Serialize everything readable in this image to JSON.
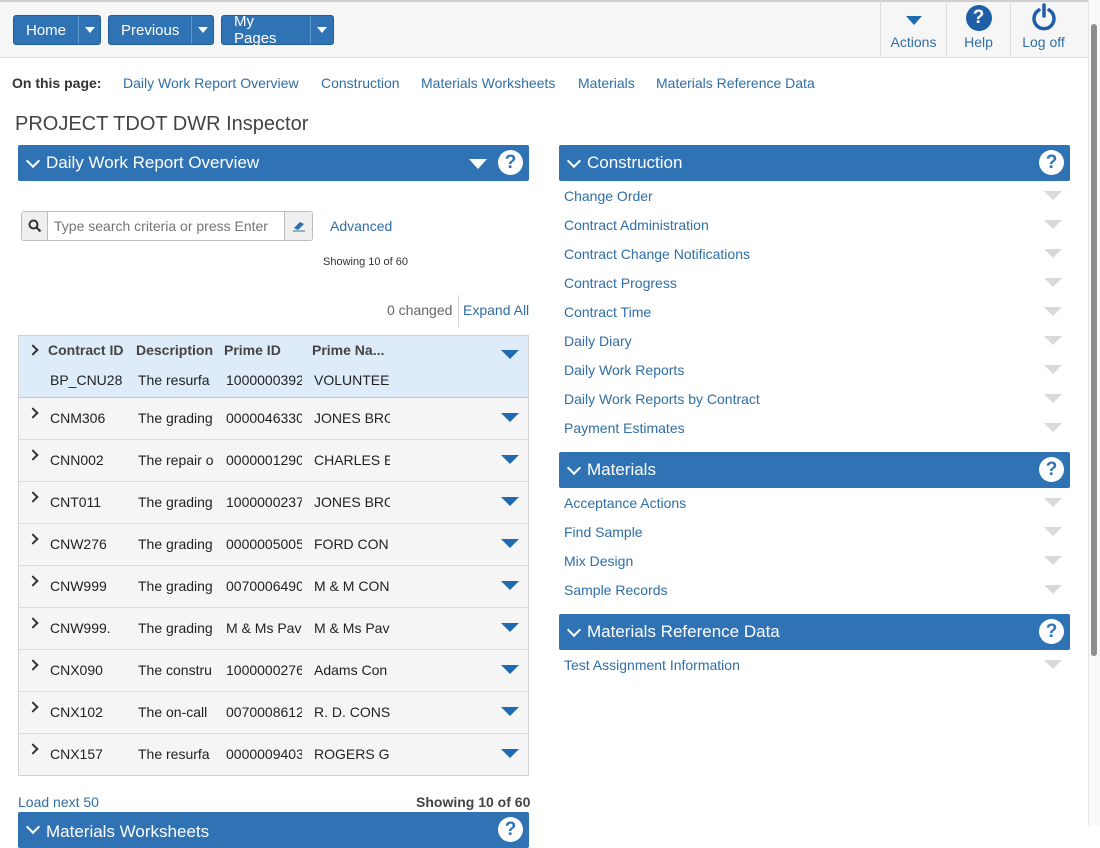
{
  "nav": {
    "home": "Home",
    "previous": "Previous",
    "my_pages": "My Pages"
  },
  "top_actions": {
    "actions": "Actions",
    "help": "Help",
    "logoff": "Log off"
  },
  "on_this_page": {
    "label": "On this page:",
    "links": [
      "Daily Work Report Overview",
      "Construction",
      "Materials Worksheets",
      "Materials",
      "Materials Reference Data"
    ]
  },
  "page_title": "PROJECT TDOT DWR Inspector",
  "dwr_panel": {
    "title": "Daily Work Report Overview",
    "search_placeholder": "Type search criteria or press Enter",
    "advanced": "Advanced",
    "showing_top": "Showing 10 of 60",
    "changed": "0 changed",
    "expand_all": "Expand All",
    "columns": [
      "Contract ID",
      "Description",
      "Prime ID",
      "Prime Na..."
    ],
    "rows": [
      [
        "BP_CNU28",
        "The resurfa",
        "1000000392",
        "VOLUNTEE"
      ],
      [
        "CNM306",
        "The grading",
        "0000046330",
        "JONES BRO"
      ],
      [
        "CNN002",
        "The repair o",
        "0000001290",
        "CHARLES E"
      ],
      [
        "CNT011",
        "The grading",
        "1000000237",
        "JONES BRO"
      ],
      [
        "CNW276",
        "The grading",
        "0000005005",
        "FORD CON"
      ],
      [
        "CNW999",
        "The grading",
        "0070006490",
        "M & M CON"
      ],
      [
        "CNW999.",
        "The grading",
        "M & Ms Pav",
        "M & Ms Pav"
      ],
      [
        "CNX090",
        "The constru",
        "1000000276",
        "Adams Con"
      ],
      [
        "CNX102",
        "The on-call",
        "0070008612",
        "R. D. CONS"
      ],
      [
        "CNX157",
        "The resurfa",
        "0000009403",
        "ROGERS G"
      ]
    ],
    "load_next": "Load next 50",
    "showing_bottom": "Showing 10 of 60",
    "next_panel_title": "Materials Worksheets"
  },
  "construction": {
    "title": "Construction",
    "items": [
      "Change Order",
      "Contract Administration",
      "Contract Change Notifications",
      "Contract Progress",
      "Contract Time",
      "Daily Diary",
      "Daily Work Reports",
      "Daily Work Reports by Contract",
      "Payment Estimates"
    ]
  },
  "materials": {
    "title": "Materials",
    "items": [
      "Acceptance Actions",
      "Find Sample",
      "Mix Design",
      "Sample Records"
    ]
  },
  "materials_ref": {
    "title": "Materials Reference Data",
    "items": [
      "Test Assignment Information"
    ]
  },
  "icons": {
    "help": "?"
  },
  "colors": {
    "accent": "#2f73b4",
    "link": "#2f6ea6",
    "header_row": "#deebf8"
  }
}
